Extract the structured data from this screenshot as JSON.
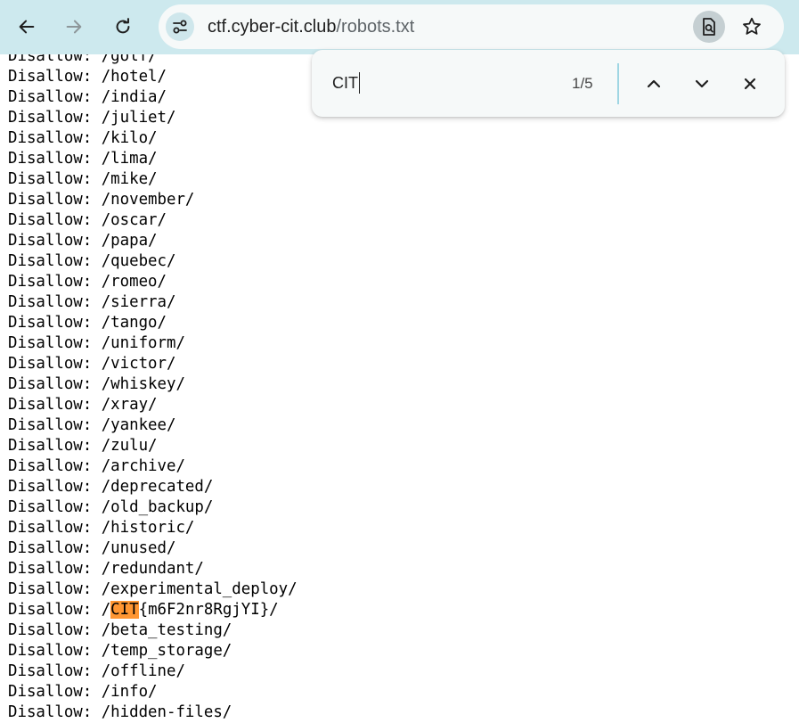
{
  "browser": {
    "back_icon": "arrow-left-icon",
    "forward_icon": "arrow-right-icon",
    "reload_icon": "reload-icon",
    "site_info_icon": "tune-icon",
    "url_host": "ctf.cyber-cit.club",
    "url_path": "/robots.txt",
    "lens_icon": "page-search-icon",
    "bookmark_icon": "star-icon",
    "toolbar_color": "#cde9ee"
  },
  "find": {
    "query": "CIT",
    "count": "1/5",
    "prev_icon": "chevron-up-icon",
    "next_icon": "chevron-down-icon",
    "close_icon": "close-icon"
  },
  "page": {
    "lines": [
      "Disallow: /golf/",
      "Disallow: /hotel/",
      "Disallow: /india/",
      "Disallow: /juliet/",
      "Disallow: /kilo/",
      "Disallow: /lima/",
      "Disallow: /mike/",
      "Disallow: /november/",
      "Disallow: /oscar/",
      "Disallow: /papa/",
      "Disallow: /quebec/",
      "Disallow: /romeo/",
      "Disallow: /sierra/",
      "Disallow: /tango/",
      "Disallow: /uniform/",
      "Disallow: /victor/",
      "Disallow: /whiskey/",
      "Disallow: /xray/",
      "Disallow: /yankee/",
      "Disallow: /zulu/",
      "Disallow: /archive/",
      "Disallow: /deprecated/",
      "Disallow: /old_backup/",
      "Disallow: /historic/",
      "Disallow: /unused/",
      "Disallow: /redundant/",
      "Disallow: /experimental_deploy/"
    ],
    "flag_line": {
      "prefix": "Disallow: /",
      "match": "CIT",
      "suffix": "{m6F2nr8RgjYI}/"
    },
    "lines_after": [
      "Disallow: /beta_testing/",
      "Disallow: /temp_storage/",
      "Disallow: /offline/",
      "Disallow: /info/",
      "Disallow: /hidden-files/"
    ],
    "highlight_color": "#ff9632"
  }
}
